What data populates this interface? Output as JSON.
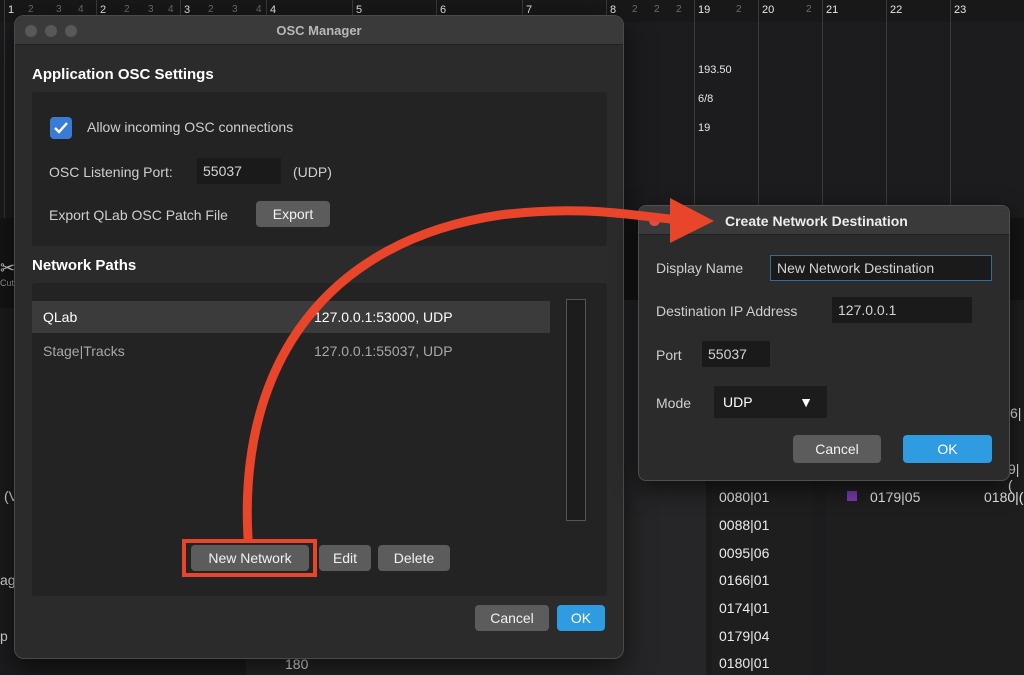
{
  "background": {
    "ruler_main": [
      "1",
      "2",
      "3",
      "4",
      "5",
      "6",
      "7",
      "8",
      "19",
      "20",
      "21",
      "22",
      "23"
    ],
    "ruler_sub": [
      "2",
      "3",
      "4",
      "2",
      "3",
      "4",
      "2",
      "3",
      "4",
      "2",
      "2",
      "2",
      "2",
      "2"
    ],
    "info_lines": [
      "193.50",
      "6/8",
      "19"
    ],
    "list_col1": [
      "0080|01",
      "0088|01",
      "0095|06",
      "0166|01",
      "0174|01",
      "0179|04",
      "0180|01"
    ],
    "list_col2": [
      "0179|05"
    ],
    "list_col2b": "0180|(",
    "bottom_num": "180",
    "edge_texts": [
      "Cut",
      "(V",
      "ag",
      "p",
      "6|",
      "9|("
    ]
  },
  "osc_manager": {
    "title": "OSC Manager",
    "app_settings_heading": "Application OSC Settings",
    "allow_incoming_label": "Allow incoming OSC connections",
    "allow_incoming_checked": true,
    "listening_port_label": "OSC Listening Port:",
    "listening_port_value": "55037",
    "listening_port_protocol": "(UDP)",
    "export_label": "Export QLab OSC Patch File",
    "export_button": "Export",
    "network_paths_heading": "Network Paths",
    "network_paths": [
      {
        "name": "QLab",
        "address": "127.0.0.1:53000, UDP"
      },
      {
        "name": "Stage|Tracks",
        "address": "127.0.0.1:55037, UDP"
      }
    ],
    "new_network_button": "New Network",
    "edit_button": "Edit",
    "delete_button": "Delete",
    "cancel_button": "Cancel",
    "ok_button": "OK"
  },
  "create_destination": {
    "title": "Create Network Destination",
    "display_name_label": "Display Name",
    "display_name_value": "New Network Destination",
    "ip_label": "Destination IP Address",
    "ip_value": "127.0.0.1",
    "port_label": "Port",
    "port_value": "55037",
    "mode_label": "Mode",
    "mode_value": "UDP",
    "cancel_button": "Cancel",
    "ok_button": "OK"
  },
  "colors": {
    "accent_blue": "#2f9be0",
    "highlight_red": "#e8452b",
    "checkbox_blue": "#3a7bd5"
  }
}
